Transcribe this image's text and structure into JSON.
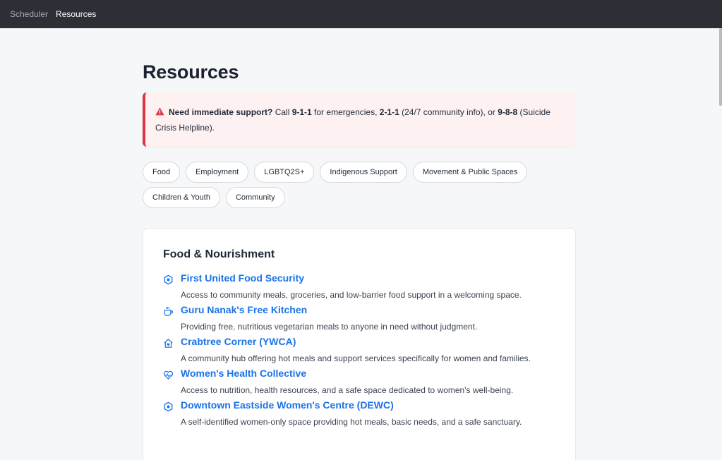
{
  "nav": {
    "items": [
      {
        "label": "Scheduler"
      },
      {
        "label": "Resources"
      }
    ]
  },
  "page": {
    "title": "Resources"
  },
  "alert": {
    "lead": "Need immediate support?",
    "t1": " Call ",
    "n1": "9-1-1",
    "t2": " for emergencies, ",
    "n2": "2-1-1",
    "t3": " (24/7 community info), or ",
    "n3": "9-8-8",
    "t4": " (Suicide Crisis Helpline).",
    "accent": "#dc3545"
  },
  "chips": [
    {
      "label": "Food"
    },
    {
      "label": "Employment"
    },
    {
      "label": "LGBTQ2S+"
    },
    {
      "label": "Indigenous Support"
    },
    {
      "label": "Movement & Public Spaces"
    },
    {
      "label": "Children & Youth"
    },
    {
      "label": "Community"
    }
  ],
  "section": {
    "title": "Food & Nourishment",
    "link_color": "#1a73e8",
    "items": [
      {
        "icon": "hexagon-dot-icon",
        "title": "First United Food Security",
        "desc": "Access to community meals, groceries, and low-barrier food support in a welcoming space."
      },
      {
        "icon": "cup-icon",
        "title": "Guru Nanak's Free Kitchen",
        "desc": "Providing free, nutritious vegetarian meals to anyone in need without judgment."
      },
      {
        "icon": "home-heart-icon",
        "title": "Crabtree Corner (YWCA)",
        "desc": "A community hub offering hot meals and support services specifically for women and families."
      },
      {
        "icon": "heart-pulse-icon",
        "title": "Women's Health Collective",
        "desc": "Access to nutrition, health resources, and a safe space dedicated to women's well-being."
      },
      {
        "icon": "hexagon-dot-icon",
        "title": "Downtown Eastside Women's Centre (DEWC)",
        "desc": "A self-identified women-only space providing hot meals, basic needs, and a safe sanctuary."
      }
    ]
  }
}
